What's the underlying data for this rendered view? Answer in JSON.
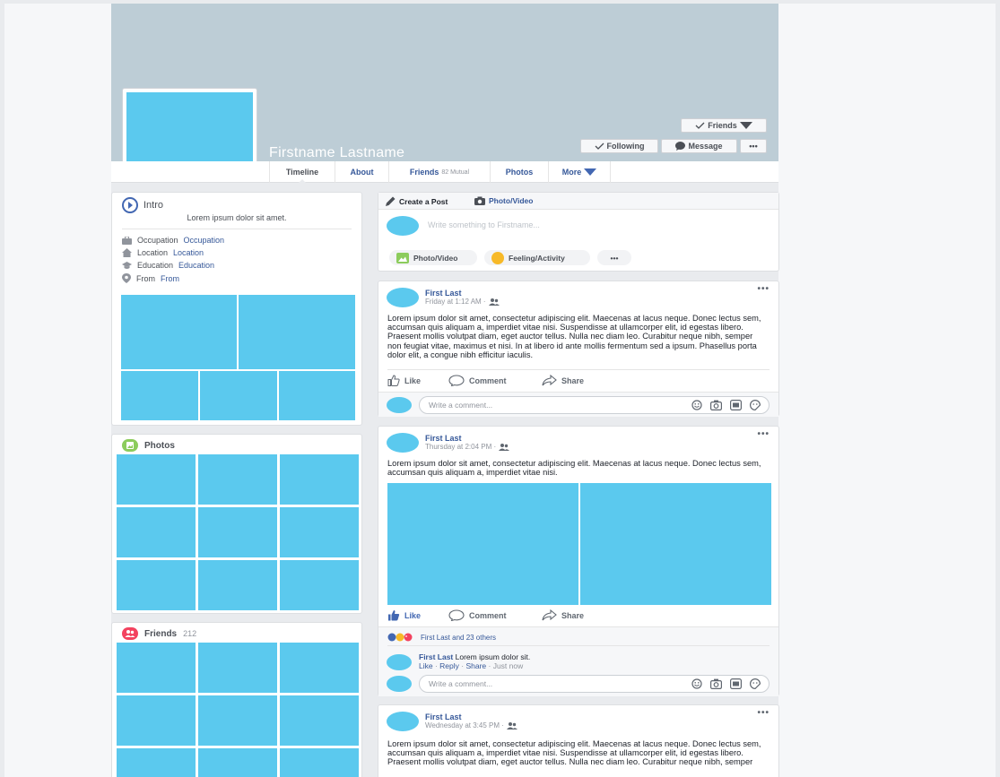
{
  "profile": {
    "name": "Firstname Lastname",
    "buttons": {
      "friends": "Friends",
      "following": "Following",
      "message": "Message",
      "more": "•••"
    }
  },
  "nav": {
    "tabs": [
      {
        "label": "Timeline",
        "sub": ""
      },
      {
        "label": "About",
        "sub": ""
      },
      {
        "label": "Friends",
        "sub": "82 Mutual"
      },
      {
        "label": "Photos",
        "sub": ""
      },
      {
        "label": "More",
        "sub": ""
      }
    ]
  },
  "intro": {
    "title": "Intro",
    "bio": "Lorem ipsum dolor sit amet.",
    "rows": [
      {
        "label": "Occupation",
        "value": "Occupation",
        "icon": "briefcase-icon"
      },
      {
        "label": "Location",
        "value": "Location",
        "icon": "home-icon"
      },
      {
        "label": "Education",
        "value": "Education",
        "icon": "graduation-cap-icon"
      },
      {
        "label": "From",
        "value": "From",
        "icon": "map-pin-icon"
      }
    ]
  },
  "photos": {
    "title": "Photos"
  },
  "friends": {
    "title": "Friends",
    "count": "212"
  },
  "composer": {
    "tab_create": "Create a Post",
    "tab_photo": "Photo/Video",
    "placeholder": "Write something to Firstname...",
    "pill_photo": "Photo/Video",
    "pill_feeling": "Feeling/Activity",
    "pill_more": "•••"
  },
  "posts": [
    {
      "author": "First Last",
      "time": "Friday at 1:12 AM ·",
      "text": "Lorem ipsum dolor sit amet, consectetur adipiscing elit. Maecenas at lacus neque. Donec lectus sem, accumsan quis aliquam a, imperdiet vitae nisi. Suspendisse at ullamcorper elit, id egestas libero. Praesent mollis volutpat diam, eget auctor tellus. Nulla nec diam leo. Curabitur neque nibh, semper non feugiat vitae, maximus et nisi. In at libero id ante mollis fermentum sed a ipsum. Phasellus porta dolor elit, a congue nibh efficitur iaculis."
    },
    {
      "author": "First Last",
      "time": "Thursday at 2:04 PM ·",
      "text": "Lorem ipsum dolor sit amet, consectetur adipiscing elit. Maecenas at lacus neque. Donec lectus sem, accumsan quis aliquam a, imperdiet vitae nisi.",
      "reactions": "First Last and 23 others",
      "comment": {
        "author": "First Last",
        "text": "Lorem ipsum dolor sit.",
        "like": "Like",
        "reply": "Reply",
        "share": "Share",
        "time": "Just now"
      }
    },
    {
      "author": "First Last",
      "time": "Wednesday at 3:45 PM ·",
      "text": "Lorem ipsum dolor sit amet, consectetur adipiscing elit. Maecenas at lacus neque. Donec lectus sem, accumsan quis aliquam a, imperdiet vitae nisi. Suspendisse at ullamcorper elit, id egestas libero. Praesent mollis volutpat diam, eget auctor tellus. Nulla nec diam leo. Curabitur neque nibh, semper"
    }
  ],
  "actions": {
    "like": "Like",
    "comment": "Comment",
    "share": "Share",
    "more": "•••"
  },
  "comment_placeholder": "Write a comment...",
  "colors": {
    "accent": "#365899",
    "placeholder_blue": "#5bc9ee",
    "cover": "#bdcdd6"
  }
}
